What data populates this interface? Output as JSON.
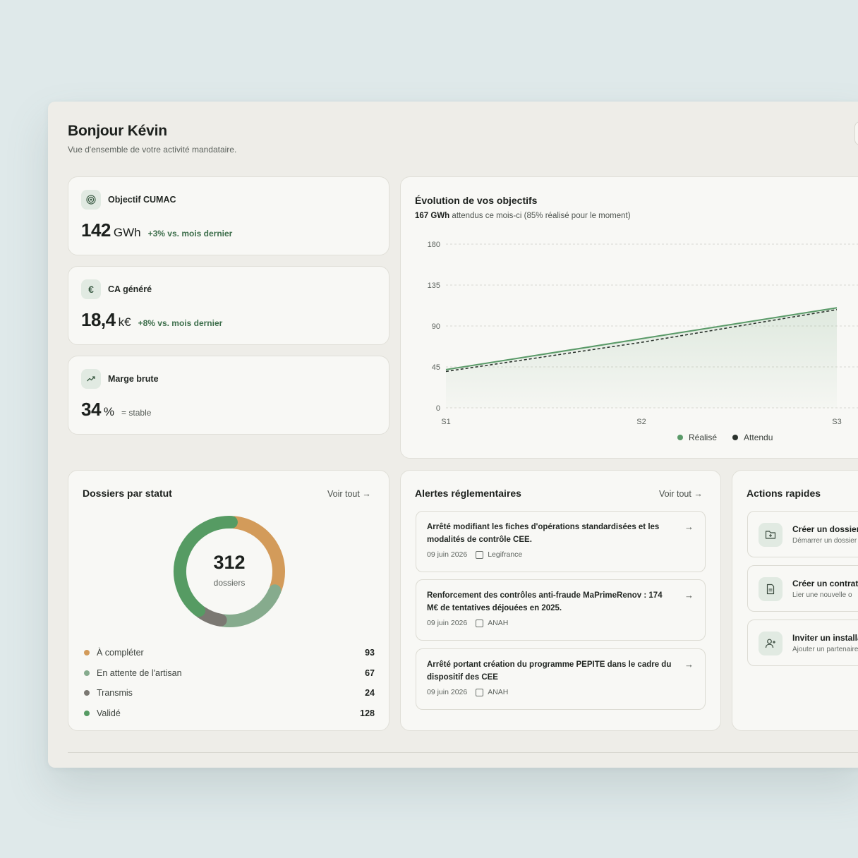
{
  "header": {
    "title": "Bonjour Kévin",
    "subtitle": "Vue d'ensemble de votre activité mandataire."
  },
  "kpis": [
    {
      "label": "Objectif CUMAC",
      "value": "142",
      "unit": "GWh",
      "delta": "+3% vs. mois dernier",
      "icon": "target-icon"
    },
    {
      "label": "CA généré",
      "value": "18,4",
      "unit": "k€",
      "delta": "+8% vs. mois dernier",
      "icon": "euro-icon"
    },
    {
      "label": "Marge brute",
      "value": "34",
      "unit": "%",
      "delta": "= stable",
      "icon": "trending-up-icon"
    }
  ],
  "evolution": {
    "title": "Évolution de vos objectifs",
    "subtitle_bold": "167 GWh",
    "subtitle_rest": "attendus ce mois-ci (85% réalisé pour le moment)",
    "legend": {
      "realise": "Réalisé",
      "attendu": "Attendu"
    },
    "colors": {
      "realise": "#5a9a68",
      "attendu": "#2b332d"
    }
  },
  "chart_data": {
    "type": "line",
    "title": "Évolution de vos objectifs",
    "categories": [
      "S1",
      "S2",
      "S3"
    ],
    "yticks": [
      "0",
      "45",
      "90",
      "135",
      "180"
    ],
    "ylim": [
      0,
      180
    ],
    "grid": true,
    "legend_position": "bottom",
    "series": [
      {
        "name": "Réalisé",
        "values": [
          42,
          76,
          110
        ],
        "style": "solid",
        "color": "#5a9a68"
      },
      {
        "name": "Attendu",
        "values": [
          40,
          72,
          108
        ],
        "style": "dashed",
        "color": "#2b332d"
      }
    ]
  },
  "dossiers": {
    "title": "Dossiers par statut",
    "see_all": "Voir tout →",
    "total": "312",
    "total_label": "dossiers",
    "statuses": [
      {
        "label": "À compléter",
        "value": 93,
        "color": "#d39b5a"
      },
      {
        "label": "En attente de l'artisan",
        "value": 67,
        "color": "#86ab8d"
      },
      {
        "label": "Transmis",
        "value": 24,
        "color": "#7b7872"
      },
      {
        "label": "Validé",
        "value": 128,
        "color": "#569b63"
      }
    ]
  },
  "alerts": {
    "title": "Alertes réglementaires",
    "see_all": "Voir tout →",
    "items": [
      {
        "text": "Arrêté modifiant les fiches d'opérations standardisées et les modalités de contrôle CEE.",
        "date": "09 juin 2026",
        "source": "Legifrance"
      },
      {
        "text": "Renforcement des contrôles anti-fraude MaPrimeRenov : 174 M€ de tentatives déjouées en 2025.",
        "date": "09 juin 2026",
        "source": "ANAH"
      },
      {
        "text": "Arrêté portant création du programme PEPITE dans le cadre du dispositif des CEE",
        "date": "09 juin 2026",
        "source": "ANAH"
      }
    ]
  },
  "quick_actions": {
    "title": "Actions rapides",
    "items": [
      {
        "title": "Créer un dossier",
        "subtitle": "Démarrer un dossier",
        "icon": "folder-plus-icon"
      },
      {
        "title": "Créer un contrat",
        "subtitle": "Lier une nouvelle o",
        "icon": "document-icon"
      },
      {
        "title": "Inviter un installateur",
        "subtitle": "Ajouter un partenaire",
        "icon": "user-plus-icon"
      }
    ]
  }
}
